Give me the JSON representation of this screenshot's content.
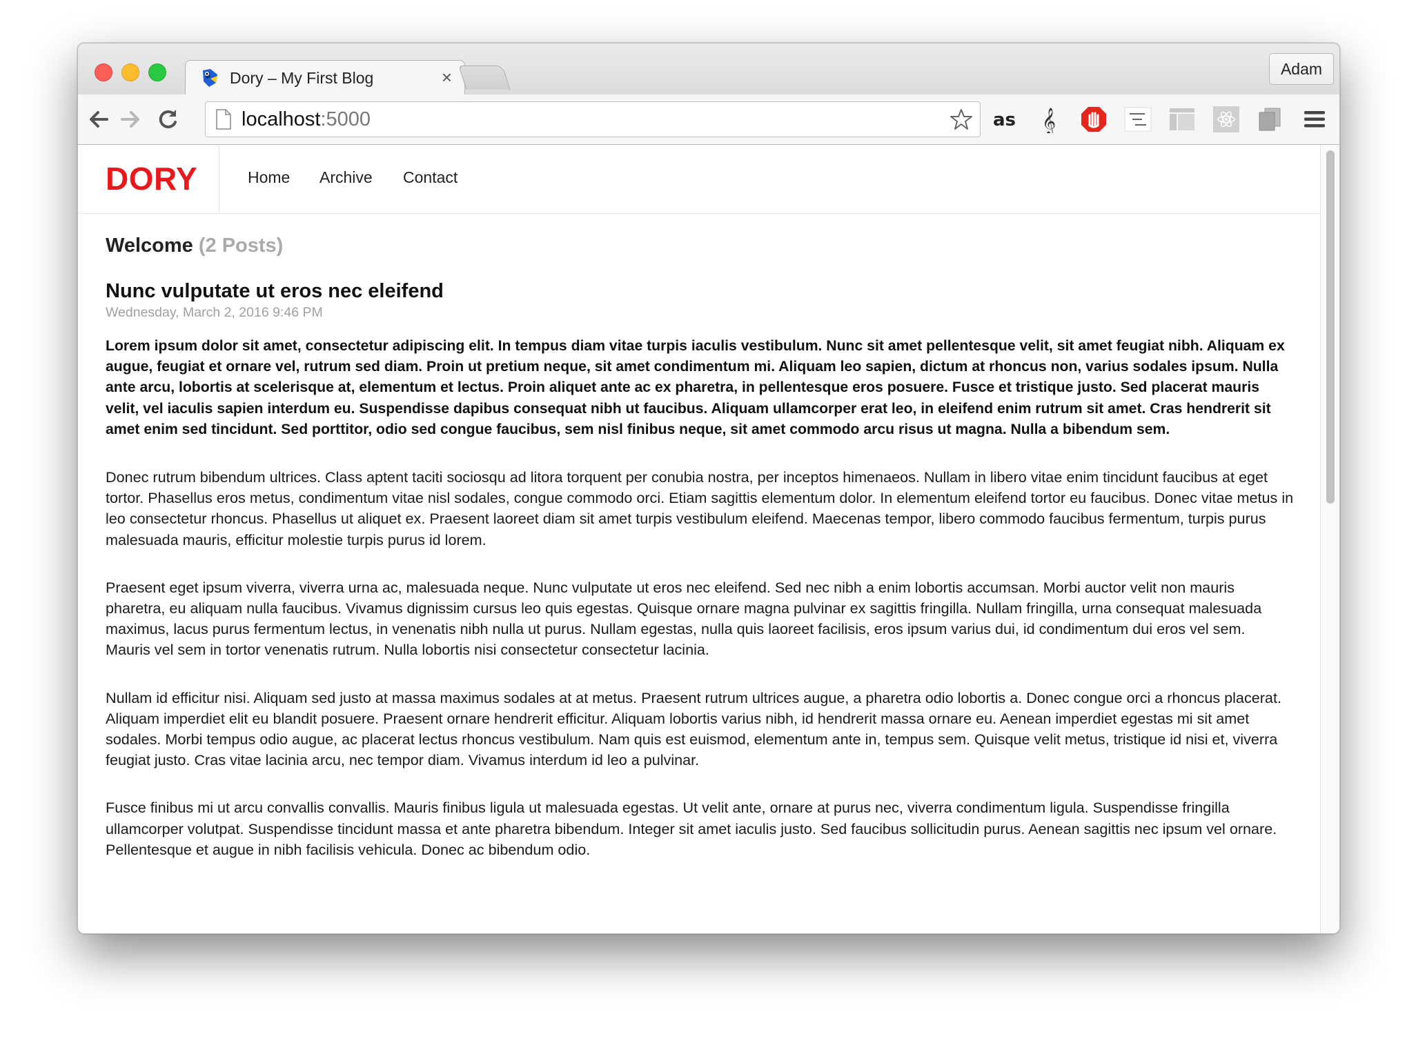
{
  "browser": {
    "tab_title": "Dory – My First Blog",
    "tab_close": "×",
    "profile_name": "Adam",
    "url_host": "localhost",
    "url_port": ":5000",
    "extension_icons": [
      "lastfm-icon",
      "treble-clef-icon",
      "hand-stop-icon",
      "enable-right-click-icon",
      "layout-icon",
      "react-icon",
      "copy-icon",
      "menu-icon"
    ]
  },
  "site": {
    "brand": "DORY",
    "nav": [
      "Home",
      "Archive",
      "Contact"
    ]
  },
  "main": {
    "heading": "Welcome",
    "post_count": "(2 Posts)",
    "post": {
      "title": "Nunc vulputate ut eros nec eleifend",
      "date": "Wednesday, March 2, 2016 9:46 PM",
      "paragraphs": [
        "Lorem ipsum dolor sit amet, consectetur adipiscing elit. In tempus diam vitae turpis iaculis vestibulum. Nunc sit amet pellentesque velit, sit amet feugiat nibh. Aliquam ex augue, feugiat et ornare vel, rutrum sed diam. Proin ut pretium neque, sit amet condimentum mi. Aliquam leo sapien, dictum at rhoncus non, varius sodales ipsum. Nulla ante arcu, lobortis at scelerisque at, elementum et lectus. Proin aliquet ante ac ex pharetra, in pellentesque eros posuere. Fusce et tristique justo. Sed placerat mauris velit, vel iaculis sapien interdum eu. Suspendisse dapibus consequat nibh ut faucibus. Aliquam ullamcorper erat leo, in eleifend enim rutrum sit amet. Cras hendrerit sit amet enim sed tincidunt. Sed porttitor, odio sed congue faucibus, sem nisl finibus neque, sit amet commodo arcu risus ut magna. Nulla a bibendum sem.",
        "Donec rutrum bibendum ultrices. Class aptent taciti sociosqu ad litora torquent per conubia nostra, per inceptos himenaeos. Nullam in libero vitae enim tincidunt faucibus at eget tortor. Phasellus eros metus, condimentum vitae nisl sodales, congue commodo orci. Etiam sagittis elementum dolor. In elementum eleifend tortor eu faucibus. Donec vitae metus in leo consectetur rhoncus. Phasellus ut aliquet ex. Praesent laoreet diam sit amet turpis vestibulum eleifend. Maecenas tempor, libero commodo faucibus fermentum, turpis purus malesuada mauris, efficitur molestie turpis purus id lorem.",
        "Praesent eget ipsum viverra, viverra urna ac, malesuada neque. Nunc vulputate ut eros nec eleifend. Sed nec nibh a enim lobortis accumsan. Morbi auctor velit non mauris pharetra, eu aliquam nulla faucibus. Vivamus dignissim cursus leo quis egestas. Quisque ornare magna pulvinar ex sagittis fringilla. Nullam fringilla, urna consequat malesuada maximus, lacus purus fermentum lectus, in venenatis nibh nulla ut purus. Nullam egestas, nulla quis laoreet facilisis, eros ipsum varius dui, id condimentum dui eros vel sem. Mauris vel sem in tortor venenatis rutrum. Nulla lobortis nisi consectetur consectetur lacinia.",
        "Nullam id efficitur nisi. Aliquam sed justo at massa maximus sodales at at metus. Praesent rutrum ultrices augue, a pharetra odio lobortis a. Donec congue orci a rhoncus placerat. Aliquam imperdiet elit eu blandit posuere. Praesent ornare hendrerit efficitur. Aliquam lobortis varius nibh, id hendrerit massa ornare eu. Aenean imperdiet egestas mi sit amet sodales. Morbi tempus odio augue, ac placerat lectus rhoncus vestibulum. Nam quis est euismod, elementum ante in, tempus sem. Quisque velit metus, tristique id nisi et, viverra feugiat justo. Cras vitae lacinia arcu, nec tempor diam. Vivamus interdum id leo a pulvinar.",
        "Fusce finibus mi ut arcu convallis convallis. Mauris finibus ligula ut malesuada egestas. Ut velit ante, ornare at purus nec, viverra condimentum ligula. Suspendisse fringilla ullamcorper volutpat. Suspendisse tincidunt massa et ante pharetra bibendum. Integer sit amet iaculis justo. Sed faucibus sollicitudin purus. Aenean sagittis nec ipsum vel ornare. Pellentesque et augue in nibh facilisis vehicula. Donec ac bibendum odio."
      ]
    }
  },
  "colors": {
    "brand": "#e8191c",
    "muted": "#aaaaaa"
  }
}
